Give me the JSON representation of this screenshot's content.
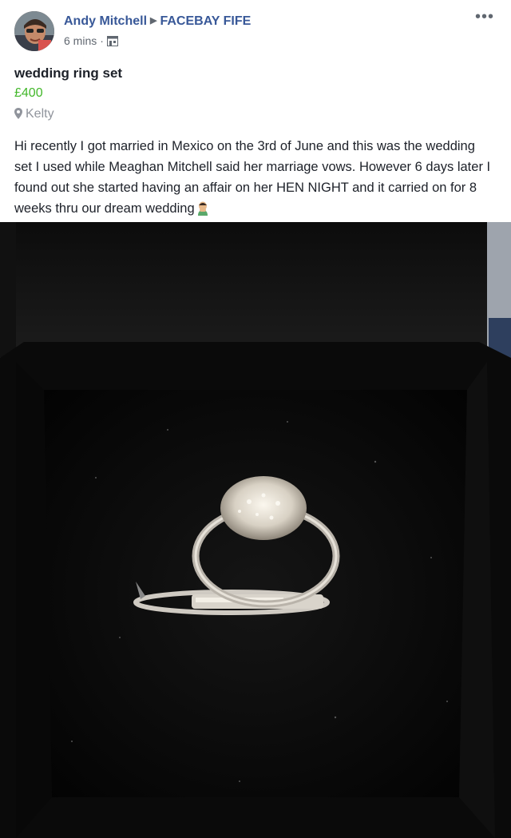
{
  "post": {
    "author": "Andy Mitchell",
    "group": "FACEBAY FIFE",
    "time": "6 mins",
    "separator": "·",
    "more_label": "•••"
  },
  "listing": {
    "title": "wedding ring set",
    "price": "£400",
    "location": "Kelty",
    "description": "Hi recently I got married in Mexico on the 3rd of June and this was the wedding set I used while Meaghan Mitchell said her marriage vows. However 6 days later I found out she started having an affair on her HEN NIGHT and it carried on for 8 weeks thru our dream wedding"
  },
  "icons": {
    "avatar": "profile-photo",
    "group_arrow": "triangle-right-icon",
    "privacy": "marketplace-icon",
    "location": "map-pin-icon",
    "emoji": "face-emoji-icon",
    "more": "ellipsis-icon"
  },
  "colors": {
    "author_link": "#385898",
    "price": "#42b72a",
    "secondary_text": "#606770"
  }
}
